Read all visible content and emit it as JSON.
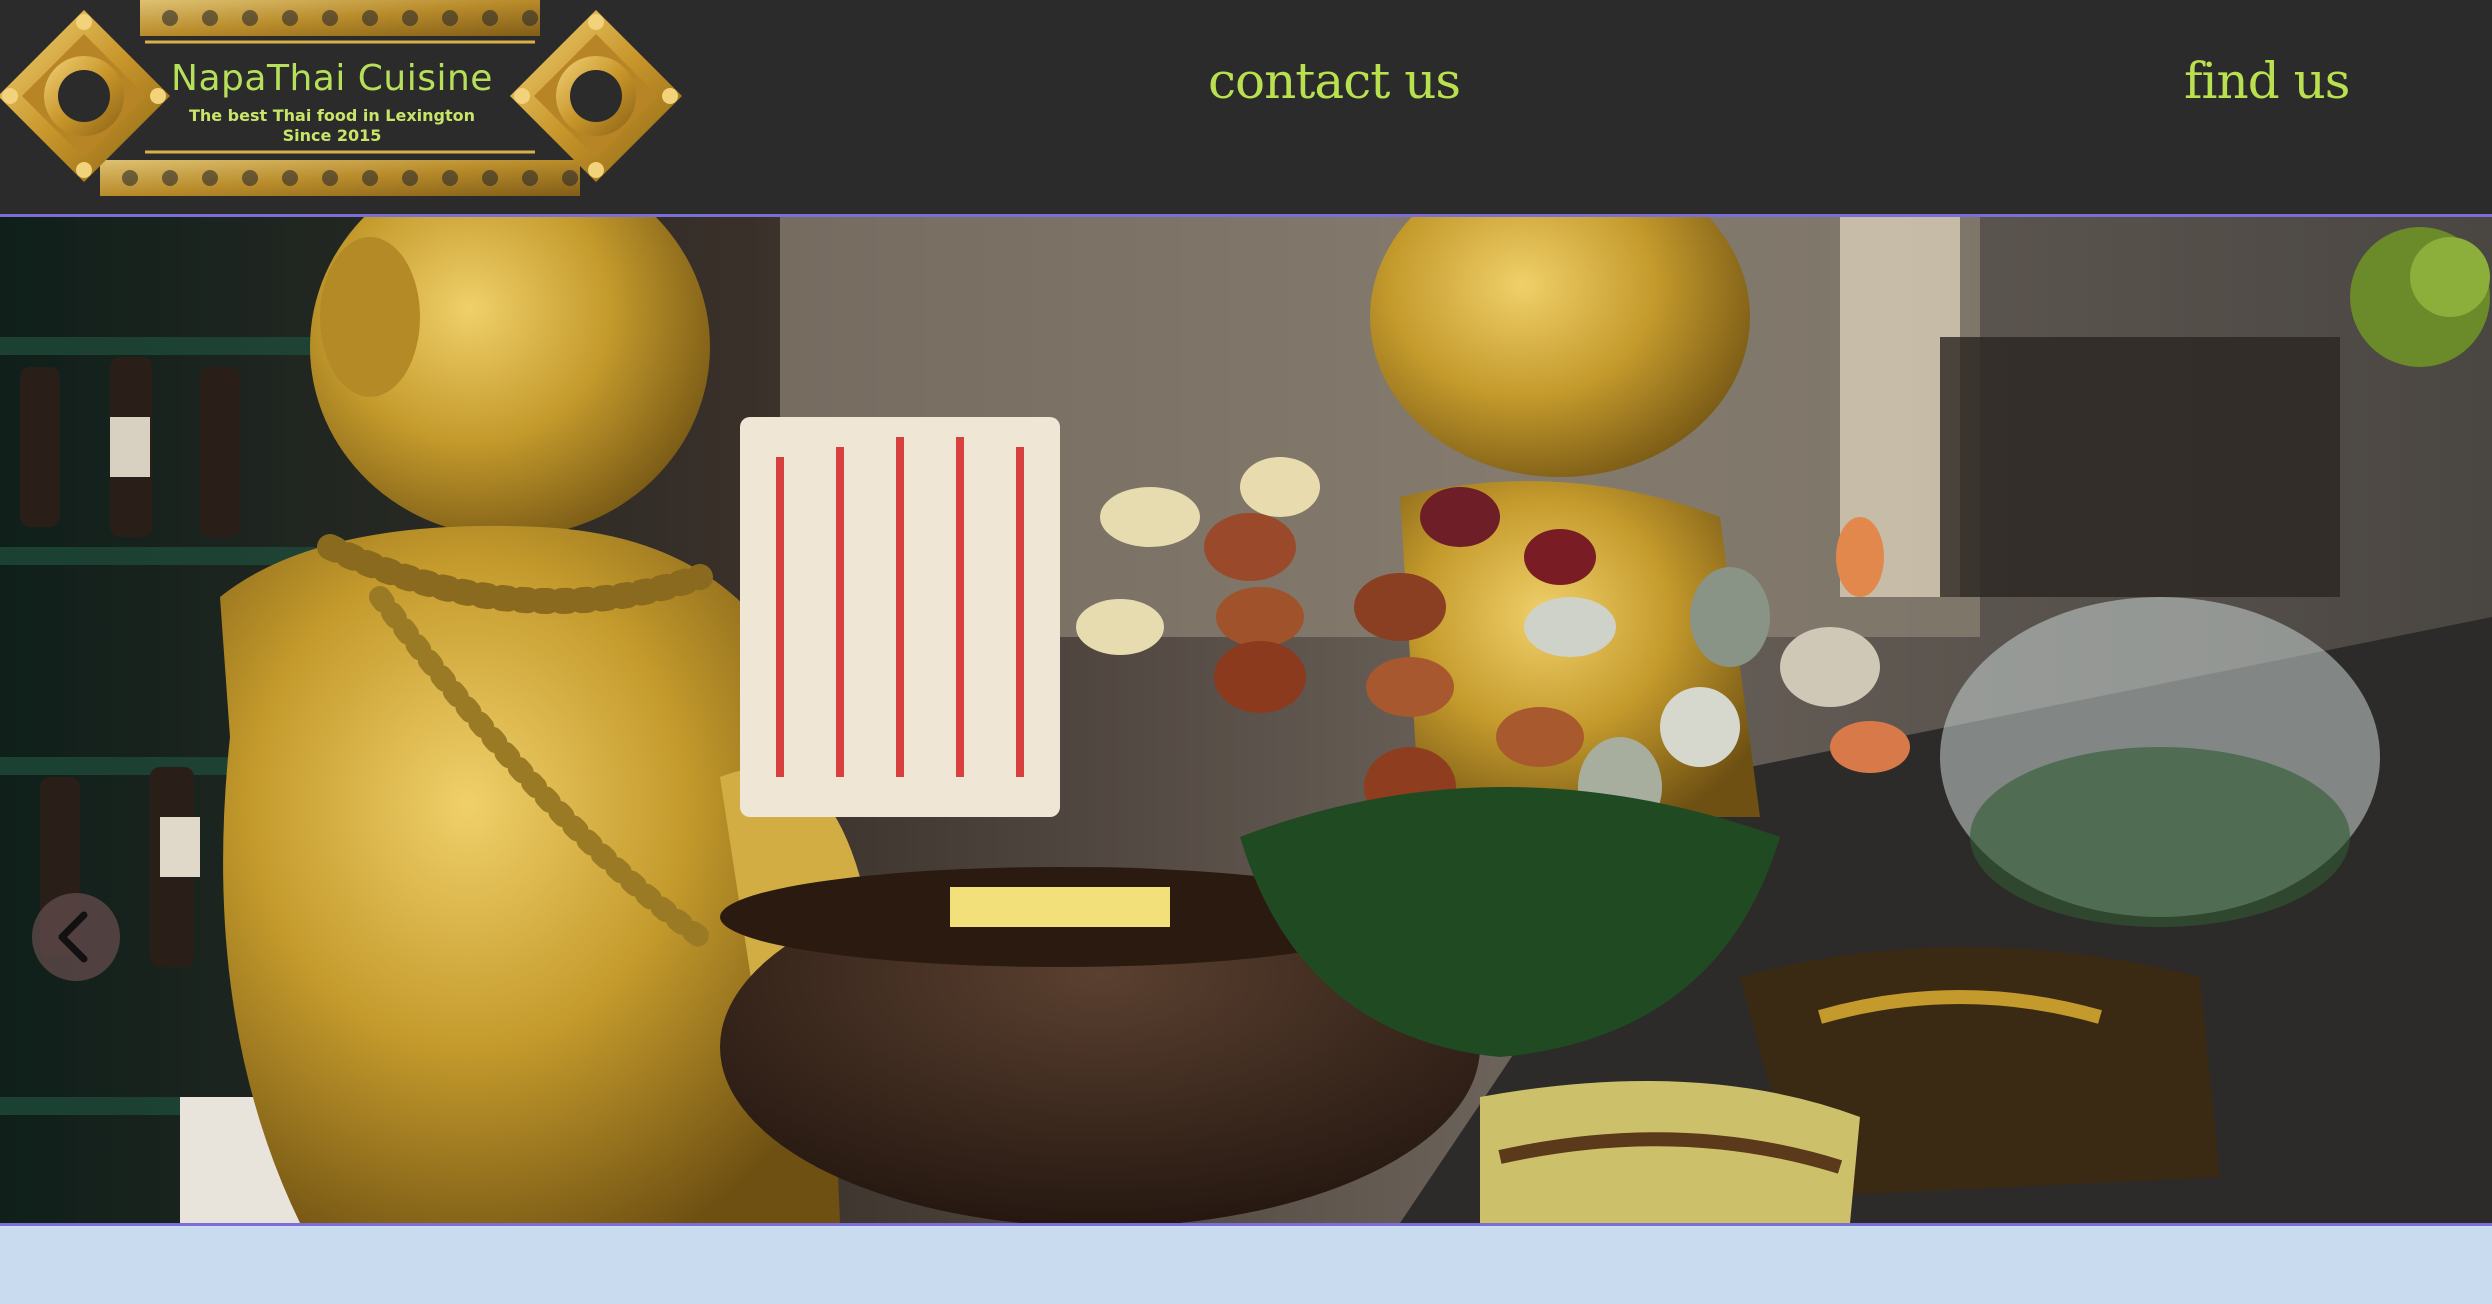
{
  "brand": {
    "name": "NapaThai Cuisine",
    "tagline_line1": "The best Thai food in Lexington",
    "tagline_line2": "Since 2015"
  },
  "nav": {
    "contact_label": "contact us",
    "find_label": "find us"
  },
  "slideshow": {
    "image_alt": "photo of golden statues holding bowls at the restaurant bar",
    "prev_icon": "chevron-left-icon"
  },
  "colors": {
    "header_bg": "#2b2b2b",
    "nav_text": "#b9e04f",
    "accent_border": "#7b6fd6",
    "footer_band": "#c8dbef",
    "gold": "#c8a032"
  }
}
